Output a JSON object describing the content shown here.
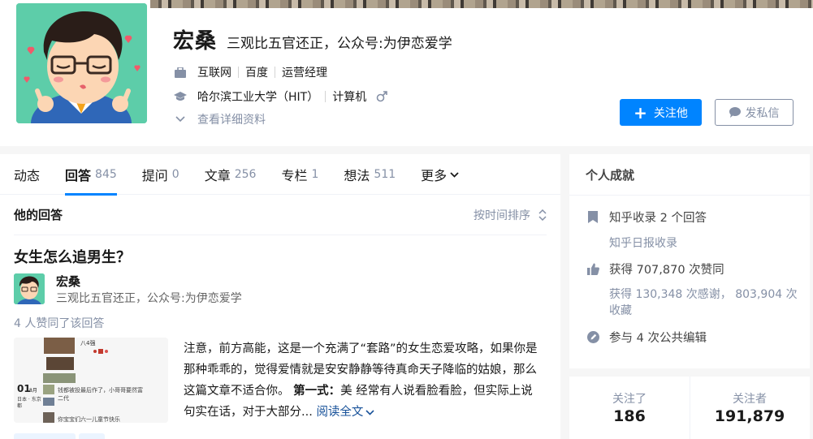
{
  "profile": {
    "name": "宏桑",
    "headline": "三观比五官还正，公众号:为伊恋爱学",
    "industry": "互联网",
    "company": "百度",
    "position": "运营经理",
    "school": "哈尔滨工业大学（HIT）",
    "major": "计算机",
    "view_details": "查看详细资料",
    "follow_button": "关注他",
    "message_button": "发私信"
  },
  "tabs": [
    {
      "label": "动态",
      "count": ""
    },
    {
      "label": "回答",
      "count": "845"
    },
    {
      "label": "提问",
      "count": "0"
    },
    {
      "label": "文章",
      "count": "256"
    },
    {
      "label": "专栏",
      "count": "1"
    },
    {
      "label": "想法",
      "count": "511"
    },
    {
      "label": "更多",
      "count": ""
    }
  ],
  "list": {
    "title": "他的回答",
    "sort_label": "按时间排序"
  },
  "answer": {
    "question": "女生怎么追男生？",
    "author_name": "宏桑",
    "author_headline": "三观比五官还正，公众号:为伊恋爱学",
    "votes_text": "4 人赞同了该回答",
    "excerpt_1": "注意，前方高能，这是一个充满了“套路”的女生恋爱攻略，如果你是那种乖乖的，觉得爱情就是安安静静等待真命天子降临的姑娘，那么这篇文章不适合你。",
    "excerpt_bold": "第一式：",
    "excerpt_2": "美 经常有人说看脸看脸，但实际上说句实在话，对于大部分...",
    "read_more": "阅读全文",
    "thumb": {
      "top_label": "八4强",
      "date_num": "01",
      "date_unit": "8月",
      "date_loc": "日本 · 东京都",
      "line1": "钱都被投最后作了，小哥哥要然富二代",
      "line2": "你宝宝们六一儿童节快乐"
    }
  },
  "achievements": {
    "title": "个人成就",
    "zhihu_included": "知乎收录 2 个回答",
    "daily_included": "知乎日报收录",
    "likes": "获得 707,870 次赞同",
    "thanks_collect": "获得 130,348 次感谢， 803,904 次收藏",
    "edits": "参与 4 次公共编辑"
  },
  "follow": {
    "following_label": "关注了",
    "following_count": "186",
    "followers_label": "关注者",
    "followers_count": "191,879"
  },
  "colors": {
    "accent": "#0084ff",
    "muted": "#8590a6",
    "link": "#175199",
    "avatar_bg": "#5dcda9"
  }
}
